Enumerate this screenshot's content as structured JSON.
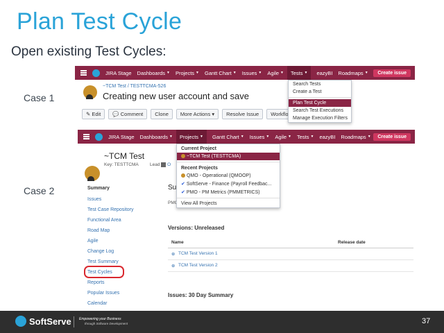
{
  "slide": {
    "title": "Plan Test Cycle",
    "subtitle": "Open existing Test Cycles:",
    "case1": "Case 1",
    "case2": "Case 2",
    "page_number": "37"
  },
  "nav": {
    "brand": "JIRA Stage",
    "items": [
      "Dashboards",
      "Projects",
      "Gantt Chart",
      "Issues",
      "Agile",
      "Tests",
      "eazyBI",
      "Roadmaps"
    ],
    "create": "Create issue"
  },
  "case1": {
    "breadcrumb": "~TCM Test / TESTTCMA-526",
    "issue_title": "Creating new user account and save",
    "buttons": [
      "Edit",
      "Comment",
      "Clone",
      "More Actions",
      "Resolve Issue",
      "Workflow"
    ],
    "tests_menu": [
      "Search Tests",
      "Create a Test",
      "Plan Test Cycle",
      "Search Test Executions",
      "Manage Execution Filters"
    ]
  },
  "case2": {
    "project_name": "~TCM Test",
    "project_key": "Key: TESTTCMA",
    "lead_label": "Lead",
    "lead_value": "O",
    "projects_menu": {
      "current_header": "Current Project",
      "current_item": "~TCM Test (TESTTCMA)",
      "recent_header": "Recent Projects",
      "recent_items": [
        "QMO - Operational (QMOOP)",
        "SoftServe - Finance (Payroll Feedbac...",
        "PMO - PM Metrics (PMMETRICS)"
      ],
      "view_all": "View All Projects"
    },
    "sidebar": {
      "header": "Summary",
      "items": [
        "Issues",
        "Test Case Repository",
        "Functional Area",
        "Road Map",
        "Agile",
        "Change Log",
        "Test Summary",
        "Test Cycles",
        "Reports",
        "Popular Issues",
        "Calendar"
      ]
    },
    "summary_partial": "Su",
    "pmo_partial": "PMO",
    "versions_title": "Versions: Unreleased",
    "versions_headers": [
      "Name",
      "Release date"
    ],
    "versions": [
      "TCM Test Version 1",
      "TCM Test Version 2"
    ],
    "issues_title": "Issues: 30 Day Summary"
  },
  "footer": {
    "brand": "SoftServe",
    "tagline_1": "Empowering your Business",
    "tagline_2": "through Software Development"
  },
  "colors": {
    "title": "#2aa3d8",
    "nav_bg": "#8a2545",
    "highlight_circle": "#d9272e",
    "footer_bg": "#2e2e2e"
  }
}
